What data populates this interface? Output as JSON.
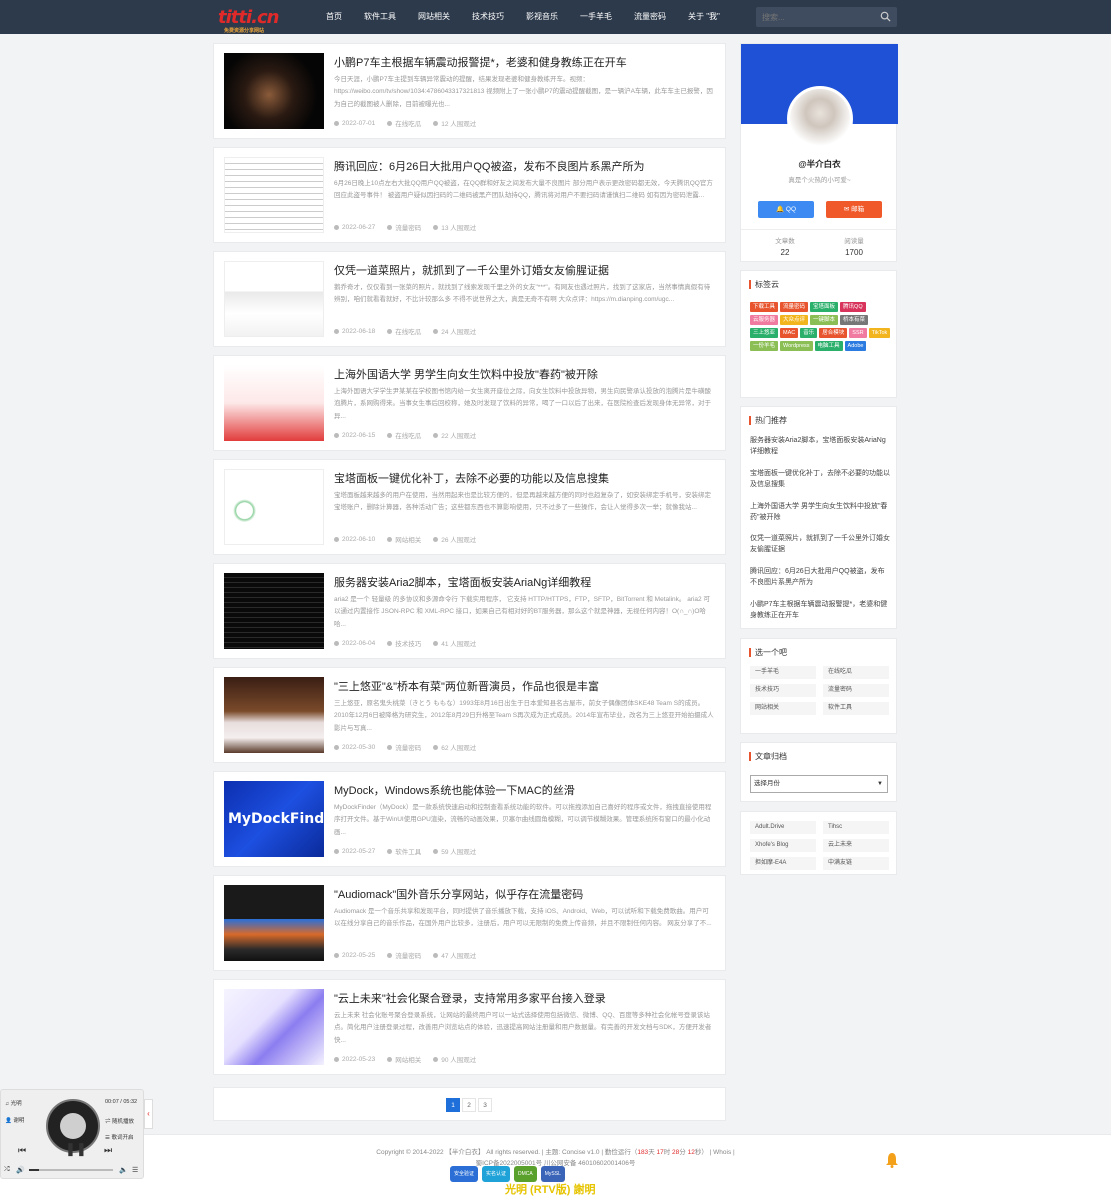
{
  "header": {
    "logo": "titti.cn",
    "logo_sub": "免费资源分享网站",
    "nav": [
      "首页",
      "软件工具",
      "网站相关",
      "技术技巧",
      "影视音乐",
      "一手羊毛",
      "流量密码",
      "关于 \"我\""
    ],
    "search_placeholder": "搜索..."
  },
  "posts": [
    {
      "title": "小鹏P7车主根据车辆震动报警提*，老婆和健身教练正在开车",
      "excerpt": "今日天涯，小鹏P7车主提到车辆异常震动的提醒，结果发现老婆和健身教练开车。视频：https://weibo.com/tv/show/1034:4786043317321813 视频附上了一张小鹏P7的震动提醒截图，是一辆沪A车辆，此车车主已报警，因为自己的截图被人删除，目前被曝光也...",
      "date": "2022-07-01",
      "cat": "在线吃瓜",
      "views": "12 人围观过"
    },
    {
      "title": "腾讯回应：6月26日大批用户QQ被盗，发布不良图片系黑产所为",
      "excerpt": "6月26日晚上10点左右大批QQ用户QQ被盗，在QQ群和好友之间发布大量不良图片 部分用户表示更改密码都无效，今天腾讯QQ官方回应此盗号事件！ 被盗用户疑似因扫码的二维码被黑产团队劫持QQ，腾讯将对用户不要扫码请谨慎扫二维码 如有因为密码泄露...",
      "date": "2022-06-27",
      "cat": "流量密码",
      "views": "13 人围观过"
    },
    {
      "title": "仅凭一道菜照片，就抓到了一千公里外订婚女友偷腥证据",
      "excerpt": "鹅乔奇才，仅仅看到一张菜的照片，就找到了线索发现千里之外的女友\"***\"。有网友也遇过照片，找到了这家店，当然事情真假有待辨别，咱们就看看就好，不比计较那么多 不得不说世界之大，真是无奇不有啊 大众点评：https://m.dianping.com/ugc...",
      "date": "2022-06-18",
      "cat": "在线吃瓜",
      "views": "24 人围观过"
    },
    {
      "title": "上海外国语大学 男学生向女生饮料中投放\"春药\"被开除",
      "excerpt": "上海外国语大学学生尹某某在学校图书馆内给一女生离开座位之际，向女生饮料中投放异物，男生向民警承认投放的泡腾片是牛磺酸泡腾片，系网购得来。当事女生事后回校称，她及时发现了饮料的异常，喝了一口以后了出来，在医院检查后发现身体无异常，对于异...",
      "date": "2022-06-15",
      "cat": "在线吃瓜",
      "views": "22 人围观过"
    },
    {
      "title": "宝塔面板一键优化补丁，去除不必要的功能以及信息搜集",
      "excerpt": "宝塔面板越来越多的用户在使用，当然用起来也是比较方便的，但是再越来越方便的同时也趋复杂了，如安装绑定手机号，安装绑定宝塔账户，删除计算器，各种活动广告；这些都东西也不算影响使用，只不过多了一些操作，会让人觉得多次一举；就像我站...",
      "date": "2022-06-10",
      "cat": "网站相关",
      "views": "26 人围观过"
    },
    {
      "title": "服务器安装Aria2脚本，宝塔面板安装AriaNg详细教程",
      "excerpt": "aria2 是一个 轻量级 的多协议和多源命令行 下载实用程序， 它支持 HTTP/HTTPS，FTP，SFTP，BitTorrent 和 Metalink。 aria2 可以通过内置接作 JSON-RPC 和 XML-RPC 接口，如果自己有相对好的BT服务器，那么这个就是神器，无视任何内容！O(∩_∩)O哈哈...",
      "date": "2022-06-04",
      "cat": "技术技巧",
      "views": "41 人围观过"
    },
    {
      "title": "\"三上悠亚\"&\"桥本有菜\"两位新晋演员，作品也很是丰富",
      "excerpt": "三上悠亚，原名鬼头桃菜（きとう ももな）1993年8月16日出生于日本爱知县名古屋市，前女子偶像团体SKE48 Team S的成员。2010年12月6日被降格为研究生，2012年8月29日升格至Team S再次成为正式成员。2014年宣布毕业，改名为三上悠亚开始拍摄成人影片与写真...",
      "date": "2022-05-30",
      "cat": "流量密码",
      "views": "62 人围观过"
    },
    {
      "title": "MyDock，Windows系统也能体验一下MAC的丝滑",
      "excerpt": "MyDockFinder（MyDock）是一款系统快速启动和控制查看系统功能的软件。可以拖拽添加自己喜好的程序或文件，拖拽直接使用程序打开文件。基于WinUI使用GPU渲染，流畅的动画效果，贝塞尔曲线圆角模糊，可以调节模糊效果。管理系统所有窗口的最小化动画...",
      "date": "2022-05-27",
      "cat": "软件工具",
      "views": "59 人围观过"
    },
    {
      "title": "\"Audiomack\"国外音乐分享网站，似乎存在流量密码",
      "excerpt": "Audiomack 是一个音乐共享和发现平台，同时提供了音乐播放下载，支持 iOS、Android、Web，可以试听和下载免费歌曲。用户可以在线分享自己的音乐作品，在国外用户比较多，注册后，用户可以无限制的免费上传音频，并且不限制任何内容。 网友分享了不...",
      "date": "2022-05-25",
      "cat": "流量密码",
      "views": "47 人围观过"
    },
    {
      "title": "\"云上未来\"社会化聚合登录，支持常用多家平台接入登录",
      "excerpt": "云上未来 社会化账号聚合登录系统，让网站的最终用户可以一站式选择使用包括微信、微博、QQ、百度等多种社会化帐号登录该站点。简化用户注册登录过程，改善用户浏览站点的体验，迅速提高网站注册量和用户数据量。有完善的开发文档与SDK，方便开发者快...",
      "date": "2022-05-23",
      "cat": "网站相关",
      "views": "90 人围观过"
    }
  ],
  "pagination": [
    "1",
    "2",
    "3"
  ],
  "profile": {
    "name": "@半介白衣",
    "signature": "真是个火热的小可爱~",
    "qq_label": "QQ",
    "mail_label": "邮箱",
    "posts_label": "文章数",
    "posts_count": "22",
    "views_label": "阅读量",
    "views_count": "1700"
  },
  "tagcloud": {
    "title": "标签云",
    "tags": [
      {
        "t": "下载工具",
        "c": "#e7542e"
      },
      {
        "t": "流量密码",
        "c": "#e7542e"
      },
      {
        "t": "宝塔面板",
        "c": "#2bb06b"
      },
      {
        "t": "腾讯QQ",
        "c": "#d8335b"
      },
      {
        "t": "云服务器",
        "c": "#f07aa0"
      },
      {
        "t": "大众点评",
        "c": "#f2b51d"
      },
      {
        "t": "一键脚本",
        "c": "#8bbf55"
      },
      {
        "t": "桥本有菜",
        "c": "#777777"
      },
      {
        "t": "三上悠亚",
        "c": "#2bb06b"
      },
      {
        "t": "MAC",
        "c": "#e7542e"
      },
      {
        "t": "音乐",
        "c": "#2bb06b"
      },
      {
        "t": "居合模块",
        "c": "#e7542e"
      },
      {
        "t": "SSR",
        "c": "#f07aa0"
      },
      {
        "t": "TikTok",
        "c": "#f2b51d"
      },
      {
        "t": "一份羊毛",
        "c": "#8bbf55"
      },
      {
        "t": "Wordpress",
        "c": "#8bbf55"
      },
      {
        "t": "电脑工具",
        "c": "#2bb06b"
      },
      {
        "t": "Adobe",
        "c": "#2b7be0"
      }
    ]
  },
  "hot": {
    "title": "热门推荐",
    "items": [
      "服务器安装Aria2脚本，宝塔面板安装AriaNg详细教程",
      "宝塔面板一键优化补丁，去除不必要的功能以及信息搜集",
      "上海外国语大学 男学生向女生饮料中投放\"春药\"被开除",
      "仅凭一道菜照片，就抓到了一千公里外订婚女友偷腥证据",
      "腾讯回应：6月26日大批用户QQ被盗，发布不良图片系黑产所为",
      "小鹏P7车主根据车辆震动报警提*，老婆和健身教练正在开车"
    ]
  },
  "categories": {
    "title": "选一个吧",
    "items": [
      "一手羊毛",
      "在线吃瓜",
      "技术技巧",
      "流量密码",
      "网站相关",
      "软件工具"
    ]
  },
  "archive": {
    "title": "文章归档",
    "select": "选择月份"
  },
  "links": {
    "items": [
      "Adult.Drive",
      "Tihsc",
      "Xhofe's Blog",
      "云上未来",
      "担如摩-E4A",
      "中满友链"
    ]
  },
  "footer": {
    "copyright_pre": "Copyright © 2014-2022 【半介白衣】 All rights reserved. | 主题: Concise v1.0 | 勤俭运行（",
    "days": "183",
    "d": "天",
    "hours": "17",
    "h": "时",
    "mins": "28",
    "m": "分",
    "secs": "12",
    "s": "秒",
    "copyright_post": "） | Whois |",
    "icp": "蜀ICP备2022005001号   川公网安备 46010602001406号",
    "badges": [
      "安全验证",
      "实名认证",
      "DMCA",
      "MySSL"
    ],
    "marquee": "光明 (RTV版) 謝明"
  },
  "player": {
    "song": "光明",
    "artist": "谢明",
    "time": "00:07 / 05:32",
    "mode": "随机播放",
    "lyrics": "歌词开启"
  }
}
